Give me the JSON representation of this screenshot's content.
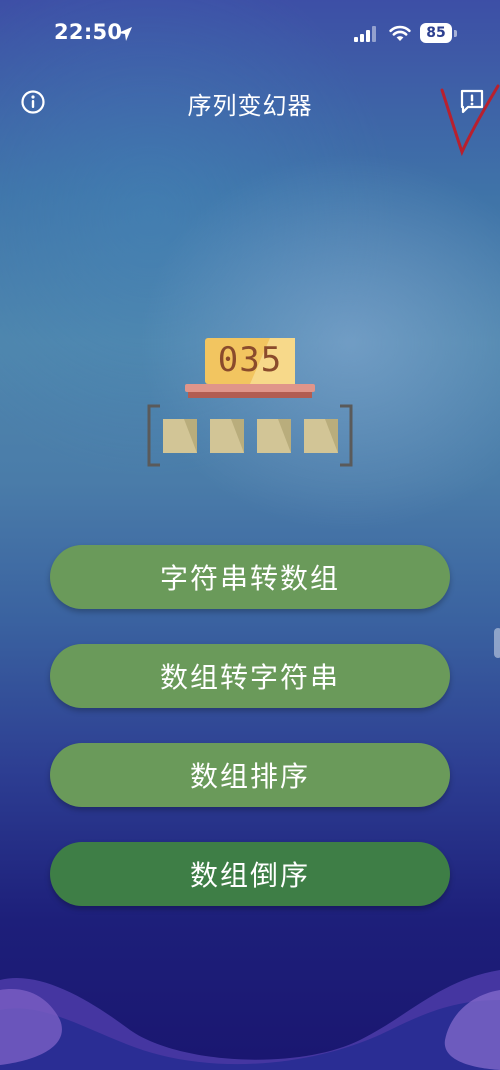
{
  "status_bar": {
    "time": "22:50",
    "battery": "85",
    "location_icon": "location-arrow-icon",
    "signal_icon": "cellular-signal-icon",
    "wifi_icon": "wifi-icon"
  },
  "nav": {
    "title": "序列变幻器",
    "left_icon": "info-icon",
    "right_icon": "feedback-icon"
  },
  "logo": {
    "sign_text": "035",
    "icon": "sequence-logo-icon"
  },
  "buttons": [
    {
      "label": "字符串转数组"
    },
    {
      "label": "数组转字符串"
    },
    {
      "label": "数组排序"
    },
    {
      "label": "数组倒序"
    }
  ],
  "colors": {
    "button": "#6a9a5a",
    "button_last": "#3e7e46",
    "sign_yellow": "#f2c560",
    "sign_text": "#8a4b2c",
    "shelf": "#c46a5e",
    "box": "#b9ad7c",
    "check_mark": "#b8202e"
  }
}
